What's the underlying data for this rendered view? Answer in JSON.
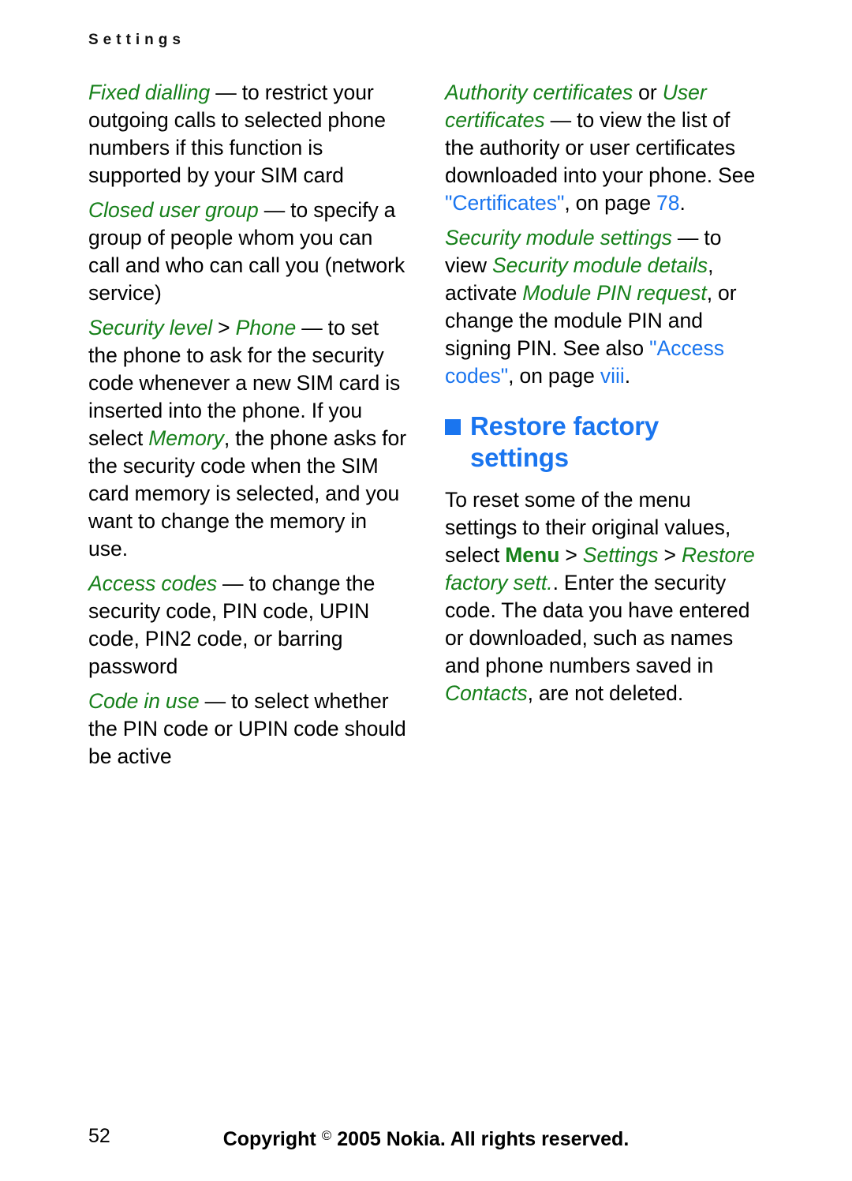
{
  "document": {
    "running_header": "Settings",
    "page_number": "52",
    "copyright_prefix": "Copyright",
    "copyright_symbol": "©",
    "copyright_suffix": "2005 Nokia. All rights reserved."
  },
  "colors": {
    "ui_term_green": "#16801a",
    "xref_blue": "#1a75ef",
    "body_black": "#000000",
    "page_background": "#ffffff"
  },
  "left_column": {
    "paragraphs": [
      {
        "id": "fixed-dialling",
        "runs": [
          {
            "style": "ui",
            "text": "Fixed dialling"
          },
          {
            "style": "plain",
            "text": " — to restrict your outgoing calls to selected phone numbers if this function is supported by your SIM card"
          }
        ]
      },
      {
        "id": "closed-user-group",
        "runs": [
          {
            "style": "ui",
            "text": "Closed user group"
          },
          {
            "style": "plain",
            "text": " — to specify a group of people whom you can call and who can call you (network service)"
          }
        ]
      },
      {
        "id": "security-level",
        "runs": [
          {
            "style": "ui",
            "text": "Security level"
          },
          {
            "style": "plain",
            "text": " > "
          },
          {
            "style": "ui",
            "text": "Phone"
          },
          {
            "style": "plain",
            "text": " — to set the phone to ask for the security code whenever a new SIM card is inserted into the phone. If you select "
          },
          {
            "style": "ui",
            "text": "Memory"
          },
          {
            "style": "plain",
            "text": ", the phone asks for the security code when the SIM card memory is selected, and you want to change the memory in use."
          }
        ]
      },
      {
        "id": "access-codes",
        "runs": [
          {
            "style": "ui",
            "text": "Access codes"
          },
          {
            "style": "plain",
            "text": " — to change the security code, PIN code, UPIN code, PIN2 code, or barring password"
          }
        ]
      },
      {
        "id": "code-in-use",
        "runs": [
          {
            "style": "ui",
            "text": "Code in use"
          },
          {
            "style": "plain",
            "text": " — to select whether the PIN code or UPIN code should be active"
          }
        ]
      }
    ]
  },
  "right_column": {
    "paragraphs_before_heading": [
      {
        "id": "certificates",
        "runs": [
          {
            "style": "ui",
            "text": "Authority certificates"
          },
          {
            "style": "plain",
            "text": " or "
          },
          {
            "style": "ui",
            "text": "User certificates"
          },
          {
            "style": "plain",
            "text": " — to view the list of the authority or user certificates downloaded into your phone. See "
          },
          {
            "style": "xref",
            "text": "\"Certificates\""
          },
          {
            "style": "plain",
            "text": ", on page "
          },
          {
            "style": "xref",
            "text": "78"
          },
          {
            "style": "plain",
            "text": "."
          }
        ]
      },
      {
        "id": "security-module-settings",
        "runs": [
          {
            "style": "ui",
            "text": "Security module settings"
          },
          {
            "style": "plain",
            "text": " — to view "
          },
          {
            "style": "ui",
            "text": "Security module details"
          },
          {
            "style": "plain",
            "text": ", activate "
          },
          {
            "style": "ui",
            "text": "Module PIN request"
          },
          {
            "style": "plain",
            "text": ", or change the module PIN and signing PIN. See also "
          },
          {
            "style": "xref",
            "text": "\"Access codes\""
          },
          {
            "style": "plain",
            "text": ", on page "
          },
          {
            "style": "xref",
            "text": "viii"
          },
          {
            "style": "plain",
            "text": "."
          }
        ]
      }
    ],
    "heading": {
      "bullet": "square",
      "text": "Restore factory settings"
    },
    "paragraphs_after_heading": [
      {
        "id": "restore-factory-body",
        "runs": [
          {
            "style": "plain",
            "text": "To reset some of the menu settings to their original values, select "
          },
          {
            "style": "ui-bold",
            "text": "Menu"
          },
          {
            "style": "plain",
            "text": " > "
          },
          {
            "style": "ui",
            "text": "Settings"
          },
          {
            "style": "plain",
            "text": " > "
          },
          {
            "style": "ui",
            "text": "Restore factory sett."
          },
          {
            "style": "plain",
            "text": ". Enter the security code. The data you have entered or downloaded, such as names and phone numbers saved in "
          },
          {
            "style": "ui",
            "text": "Contacts"
          },
          {
            "style": "plain",
            "text": ", are not deleted."
          }
        ]
      }
    ]
  }
}
